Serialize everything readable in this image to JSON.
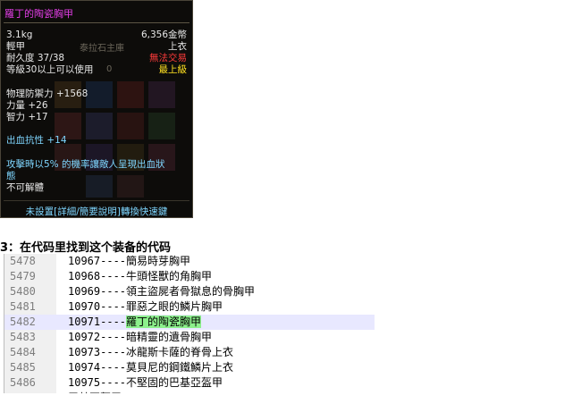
{
  "tooltip": {
    "title": "羅丁的陶瓷胸甲",
    "weight": "3.1kg",
    "price": "6,356金幣",
    "armor_type": "輕甲",
    "slot": "上衣",
    "durability": "耐久度 37/38",
    "trade": "無法交易",
    "level_req": "等級30以上可以使用",
    "grade": "最上級",
    "ghost_tab": "泰拉石主庫",
    "ghost_num": "0",
    "stats": [
      "物理防禦力 +1568",
      "力量 +26",
      "智力 +17"
    ],
    "bleed_resist": "出血抗性 +14",
    "effect_line1": "攻擊時以5% 的機率讓敵人呈現出血狀",
    "effect_line2": "態",
    "undismantle": "不可解體",
    "footer": "未設置[詳細/簡要說明]轉換快速鍵"
  },
  "caption": "3：在代码里找到这个装备的代码",
  "code": {
    "lines": [
      {
        "num": "5478",
        "id": "10967----",
        "name": "簡易時芽胸甲"
      },
      {
        "num": "5479",
        "id": "10968----",
        "name": "牛頭怪獸的角胸甲"
      },
      {
        "num": "5480",
        "id": "10969----",
        "name": "領主盜屍者骨獄息的骨胸甲"
      },
      {
        "num": "5481",
        "id": "10970----",
        "name": "罪惡之眼的鱗片胸甲"
      },
      {
        "num": "5482",
        "id": "10971----",
        "name": "羅丁的陶瓷胸甲"
      },
      {
        "num": "5483",
        "id": "10972----",
        "name": "暗精靈的遺骨胸甲"
      },
      {
        "num": "5484",
        "id": "10973----",
        "name": "冰龍斯卡薩的脊骨上衣"
      },
      {
        "num": "5485",
        "id": "10974----",
        "name": "莫貝尼的鋼鐵鱗片上衣"
      },
      {
        "num": "5486",
        "id": "10975----",
        "name": "不堅固的巴基亞盔甲"
      },
      {
        "num": "",
        "id": "",
        "name": "甲基亞盔甲"
      }
    ],
    "highlight_index": 4
  }
}
